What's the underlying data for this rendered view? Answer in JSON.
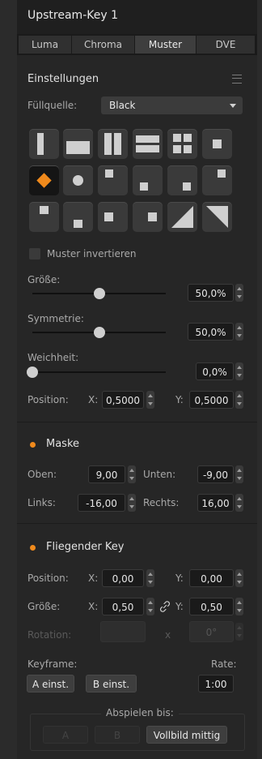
{
  "title": "Upstream-Key 1",
  "tabs": [
    "Luma",
    "Chroma",
    "Muster",
    "DVE"
  ],
  "active_tab": "Muster",
  "settings": {
    "heading": "Einstellungen",
    "fill_source_label": "Füllquelle:",
    "fill_source_value": "Black",
    "patterns": [
      "left-bar",
      "horizontal-bar",
      "two-vertical-bars",
      "two-horizontal-bars",
      "four-squares",
      "center-square",
      "diamond",
      "circle",
      "top-left-box",
      "bottom-left-box",
      "bottom-right-box",
      "top-right-box",
      "top-center-box",
      "bottom-center-box",
      "left-center-box",
      "right-center-box",
      "diagonal-left",
      "diagonal-right"
    ],
    "selected_pattern": "diamond",
    "invert_label": "Muster invertieren",
    "invert_checked": false,
    "size_label": "Größe:",
    "size_value": "50,0%",
    "size_fraction": 0.5,
    "symmetry_label": "Symmetrie:",
    "symmetry_value": "50,0%",
    "symmetry_fraction": 0.5,
    "softness_label": "Weichheit:",
    "softness_value": "0,0%",
    "softness_fraction": 0.0,
    "position_label": "Position:",
    "x_label": "X:",
    "x_value": "0,5000",
    "y_label": "Y:",
    "y_value": "0,5000"
  },
  "mask": {
    "heading": "Maske",
    "top_label": "Oben:",
    "top_value": "9,00",
    "bottom_label": "Unten:",
    "bottom_value": "-9,00",
    "left_label": "Links:",
    "left_value": "-16,00",
    "right_label": "Rechts:",
    "right_value": "16,00"
  },
  "flying_key": {
    "heading": "Fliegender Key",
    "position_label": "Position:",
    "pos_x_label": "X:",
    "pos_x_value": "0,00",
    "pos_y_label": "Y:",
    "pos_y_value": "0,00",
    "size_label": "Größe:",
    "size_x_label": "X:",
    "size_x_value": "0,50",
    "size_y_label": "Y:",
    "size_y_value": "0,50",
    "rotation_label": "Rotation:",
    "rotation_x": "x",
    "rotation_value": "0°",
    "keyframe_label": "Keyframe:",
    "set_a_label": "A einst.",
    "set_b_label": "B einst.",
    "rate_label": "Rate:",
    "rate_value": "1:00",
    "play_to_label": "Abspielen bis:",
    "play_a_label": "A",
    "play_b_label": "B",
    "play_full_label": "Vollbild mittig"
  },
  "colors": {
    "accent": "#f08a1c",
    "panel": "#262626",
    "field": "#1a1a1a"
  }
}
